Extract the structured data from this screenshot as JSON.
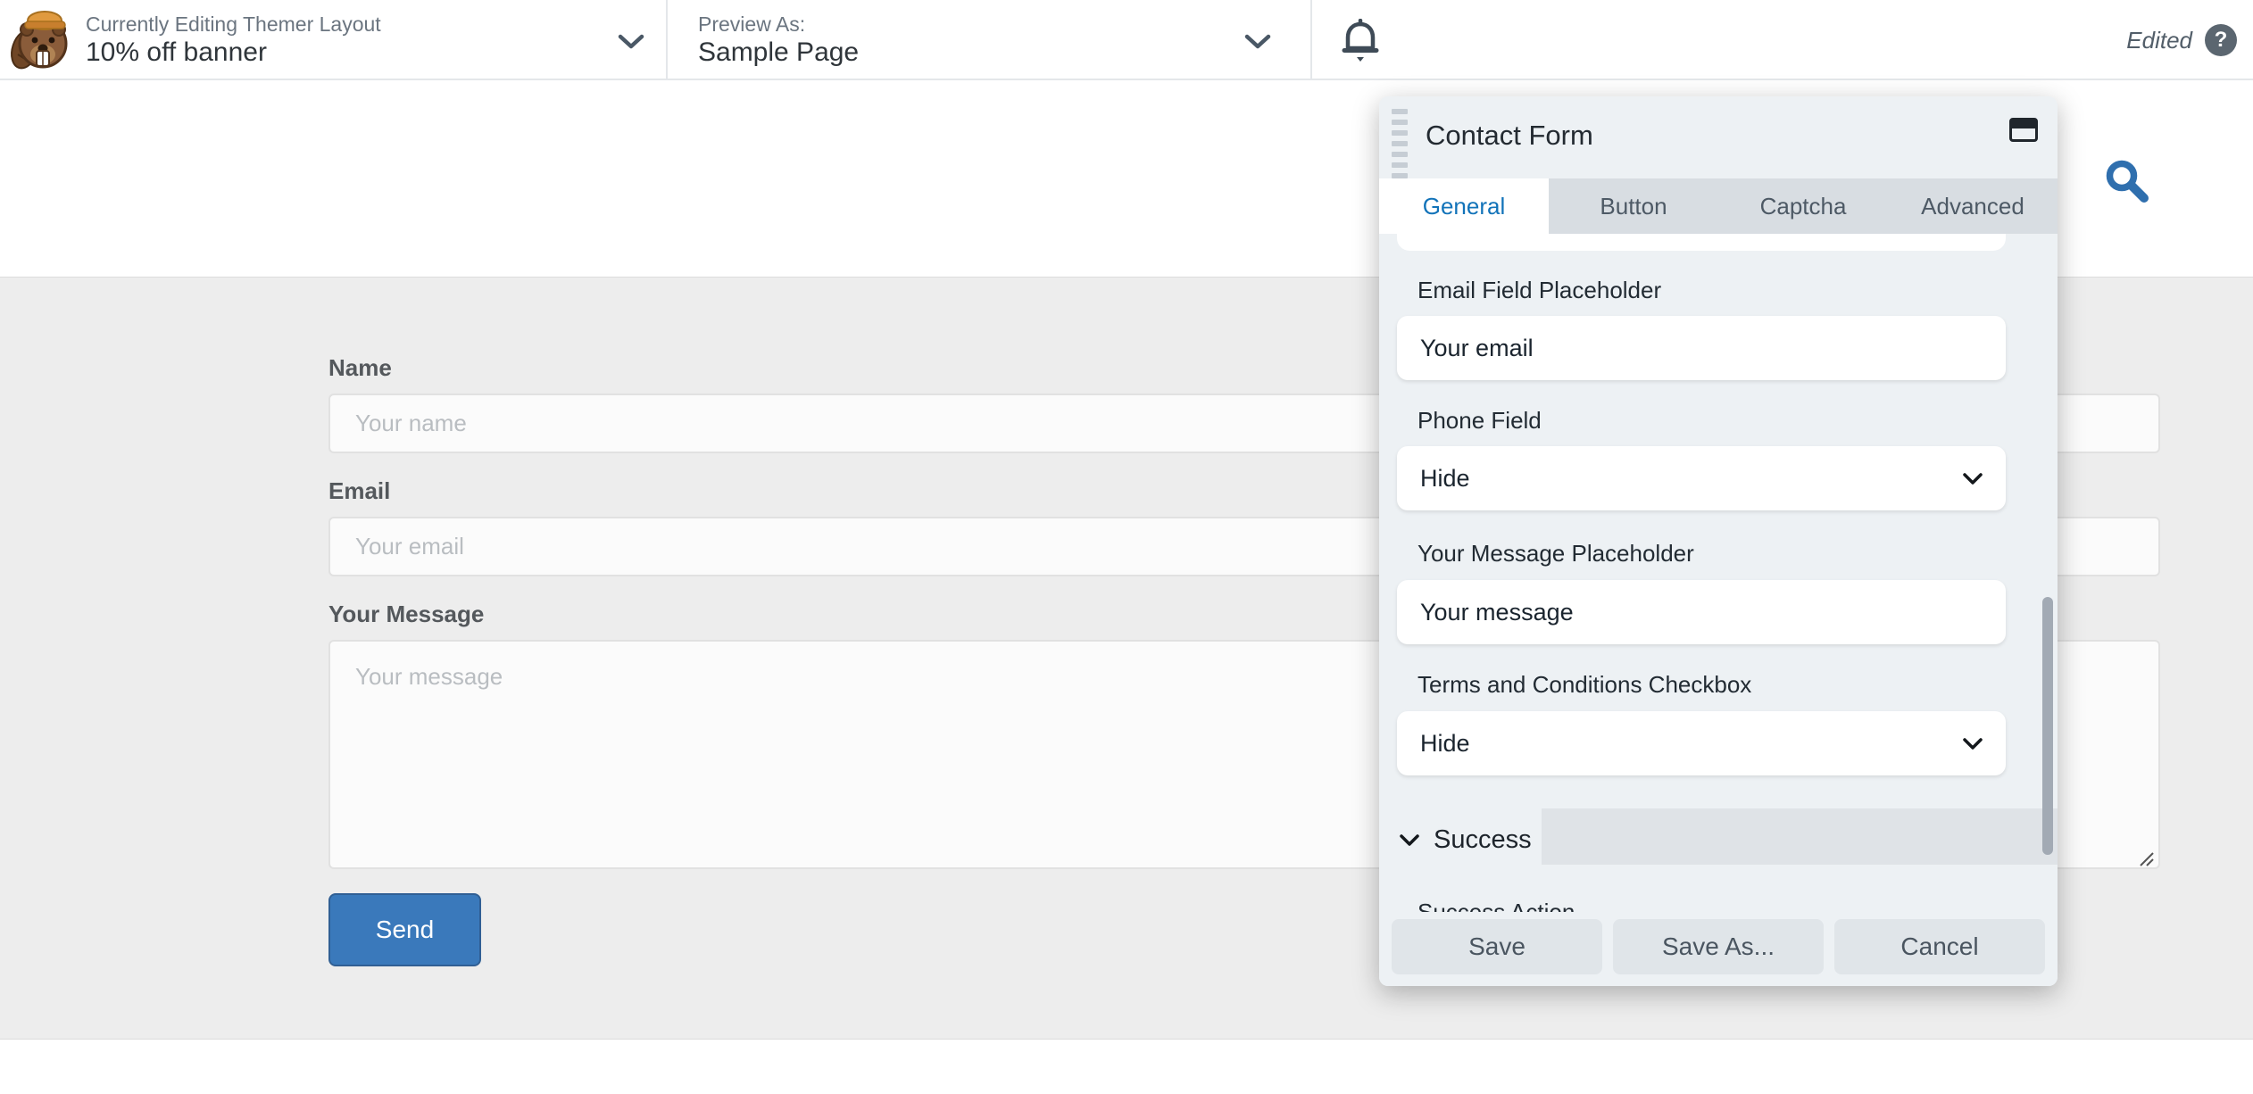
{
  "header": {
    "editing_label": "Currently Editing Themer Layout",
    "editing_title": "10% off banner",
    "preview_label": "Preview As:",
    "preview_value": "Sample Page",
    "edited_badge": "Edited",
    "help_glyph": "?"
  },
  "page": {
    "fields": [
      {
        "label": "Name",
        "placeholder": "Your name"
      },
      {
        "label": "Email",
        "placeholder": "Your email"
      },
      {
        "label": "Your Message",
        "placeholder": "Your message"
      }
    ],
    "send_button": "Send"
  },
  "panel": {
    "title": "Contact Form",
    "tabs": [
      {
        "label": "General",
        "active": true
      },
      {
        "label": "Button",
        "active": false
      },
      {
        "label": "Captcha",
        "active": false
      },
      {
        "label": "Advanced",
        "active": false
      }
    ],
    "fields": [
      {
        "label": "Email Field Placeholder",
        "type": "text",
        "value": "Your email"
      },
      {
        "label": "Phone Field",
        "type": "select",
        "value": "Hide"
      },
      {
        "label": "Your Message Placeholder",
        "type": "text",
        "value": "Your message"
      },
      {
        "label": "Terms and Conditions Checkbox",
        "type": "select",
        "value": "Hide"
      }
    ],
    "section_label": "Success",
    "clipped_label": "Success Action",
    "footer_buttons": [
      "Save",
      "Save As...",
      "Cancel"
    ]
  },
  "colors": {
    "accent_blue": "#1273b9",
    "send_button": "#3a79bb",
    "panel_bg": "#edf1f4",
    "tab_inactive_bg": "#d8dde2",
    "canvas_bg": "#ededed",
    "footer_button_bg": "#e0e5e9",
    "success_row_bg": "#dfe3e7"
  }
}
